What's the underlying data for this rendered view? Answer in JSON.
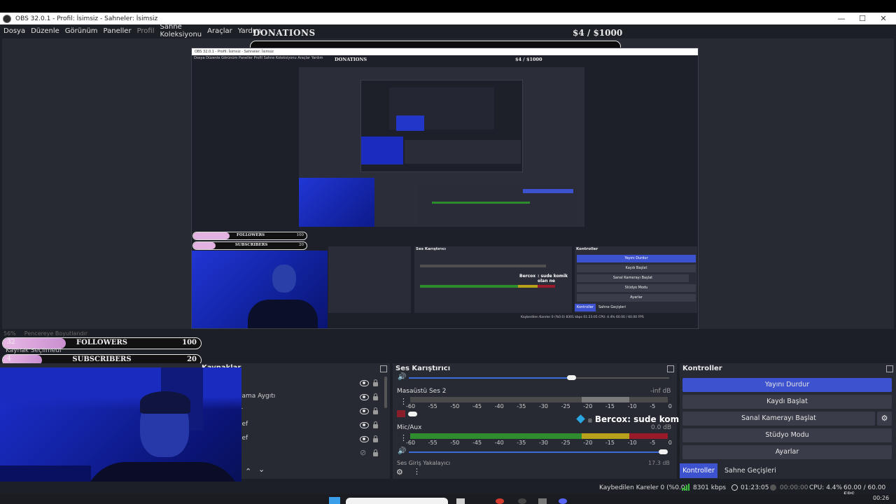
{
  "window": {
    "title": "OBS 32.0.1 - Profil: İsimsiz - Sahneler: İsimsiz",
    "controls": [
      "—",
      "☐",
      "✕"
    ]
  },
  "menu": [
    "Dosya",
    "Düzenle",
    "Görünüm",
    "Paneller",
    "Profil",
    "Sahne Koleksiyonu",
    "Araçlar",
    "Yardım"
  ],
  "donations": {
    "label": "DONATIONS",
    "amount": "$4  / $1000",
    "progress": 0.004
  },
  "nested_preview": {
    "title": "OBS 32.0.1 - Profil: İsimsiz - Sahneler: İsimsiz",
    "menu": "Dosya  Düzenle  Görünüm  Paneller  Profil  Sahne Koleksiyonu  Araçlar  Yardım",
    "donations": "DONATIONS",
    "amount": "$4  / $1000",
    "followers": "FOLLOWERS",
    "followers_value": "100",
    "subscribers": "SUBSCRIBERS",
    "subscribers_value": "20",
    "mixer": "Ses Karıştırıcı",
    "controls": "Kontroller",
    "buttons": [
      "Yayını Durdur",
      "Kaydı Başlat",
      "Sanal Kamerayı Başlat",
      "Stüdyo Modu",
      "Ayarlar"
    ],
    "tabs": [
      "Kontroller",
      "Sahne Geçişleri"
    ],
    "chat_user": "Bercox",
    "chat_msg": ": sude komik olan ne",
    "status": "Kaybedilen Kareler 0 (%0.0)   8301 kbps   01:23:05   CPU: 4.4%   60.00 / 60.00 FPS"
  },
  "preview_status": {
    "zoom": "56%",
    "fit": "Pencereye Boyutlandır"
  },
  "followers": {
    "label": "FOLLOWERS",
    "value": "100",
    "count": "32",
    "progress": 0.32
  },
  "subscribers": {
    "label": "SUBSCRIBERS",
    "value": "20",
    "count": "4",
    "progress": 0.2
  },
  "sources": {
    "header": "Kaynaklar",
    "items": [
      "Kaynak Seçilmedi",
      "lama Aygıtı",
      "r",
      "lef",
      "lef",
      ""
    ]
  },
  "mixer": {
    "title": "Ses Karıştırıcı",
    "tracks": [
      {
        "name": "Masaüstü Ses 2",
        "level": "-inf dB"
      },
      {
        "name": "Mic/Aux",
        "level": "0.0 dB"
      },
      {
        "name": "Ses Giriş Yakalayıcı",
        "level": "17.3 dB"
      }
    ],
    "ticks": [
      "-60",
      "-55",
      "-50",
      "-45",
      "-40",
      "-35",
      "-30",
      "-25",
      "-20",
      "-15",
      "-10",
      "-5",
      "0"
    ]
  },
  "controls": {
    "title": "Kontroller",
    "buttons": [
      "Yayını Durdur",
      "Kaydı Başlat",
      "Sanal Kamerayı Başlat",
      "Stüdyo Modu",
      "Ayarlar"
    ],
    "tabs": [
      "Kontroller",
      "Sahne Geçişleri"
    ]
  },
  "chat": {
    "user": "Bercox",
    "message": ": sude komik olan ne"
  },
  "status": {
    "dropped": "Kaybedilen Kareler 0 (%0.0)",
    "bitrate": "8301 kbps",
    "live_time": "01:23:05",
    "rec_time": "00:00:00",
    "cpu": "CPU: 4.4%",
    "fps": "60.00 / 60.00 FPS"
  },
  "taskbar": {
    "clock": "00:26"
  },
  "colors": {
    "accent": "#3d52cf",
    "panel": "#272a33",
    "bg": "#1d1f26",
    "meter_green": "#2e8b2e",
    "meter_yellow": "#b8a21c",
    "meter_red": "#9b1a2a"
  }
}
